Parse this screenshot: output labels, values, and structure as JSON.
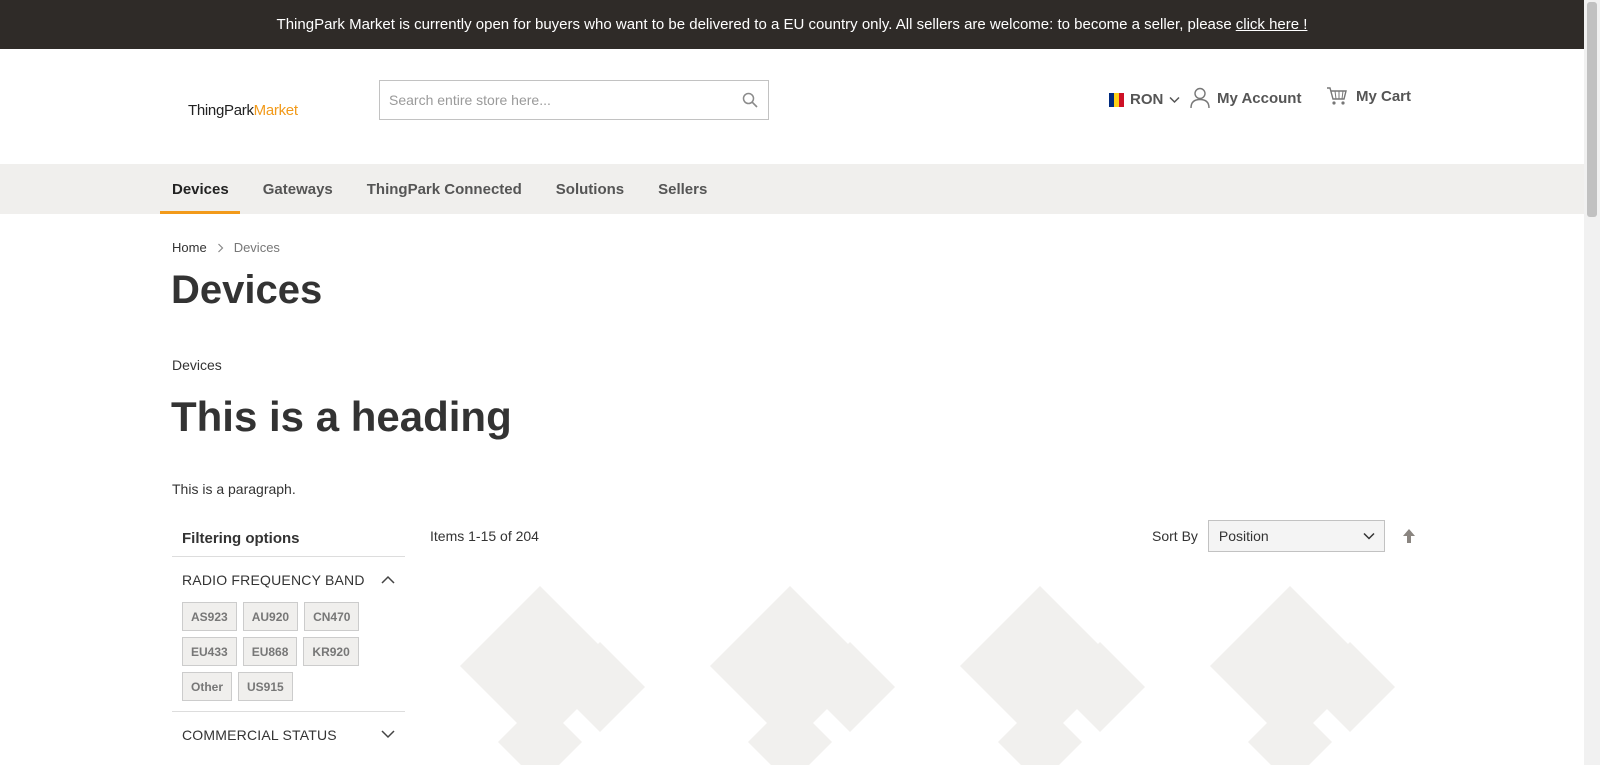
{
  "notice": {
    "text": "ThingPark Market is currently open for buyers who want to be delivered to a EU country only. All sellers are welcome: to become a seller, please",
    "link": "click here !"
  },
  "header": {
    "logo_part1": "ThingPark",
    "logo_part2": "Market",
    "search_placeholder": "Search entire store here...",
    "currency": "RON",
    "account": "My Account",
    "cart": "My Cart"
  },
  "nav": {
    "items": [
      {
        "label": "Devices"
      },
      {
        "label": "Gateways"
      },
      {
        "label": "ThingPark Connected"
      },
      {
        "label": "Solutions"
      },
      {
        "label": "Sellers"
      }
    ]
  },
  "breadcrumb": {
    "home": "Home",
    "current": "Devices"
  },
  "page": {
    "title": "Devices",
    "category_label": "Devices",
    "heading": "This is a heading",
    "paragraph": "This is a paragraph."
  },
  "filters": {
    "title": "Filtering options",
    "rf_band": {
      "label": "RADIO FREQUENCY BAND",
      "options": [
        "AS923",
        "AU920",
        "CN470",
        "EU433",
        "EU868",
        "KR920",
        "Other",
        "US915"
      ]
    },
    "commercial_status": {
      "label": "COMMERCIAL STATUS"
    }
  },
  "toolbar": {
    "count": "Items 1-15 of 204",
    "sort_label": "Sort By",
    "sort_value": "Position"
  },
  "colors": {
    "accent": "#f29a1a",
    "topbar": "#2f2b28",
    "nav_bg": "#f0efed"
  }
}
